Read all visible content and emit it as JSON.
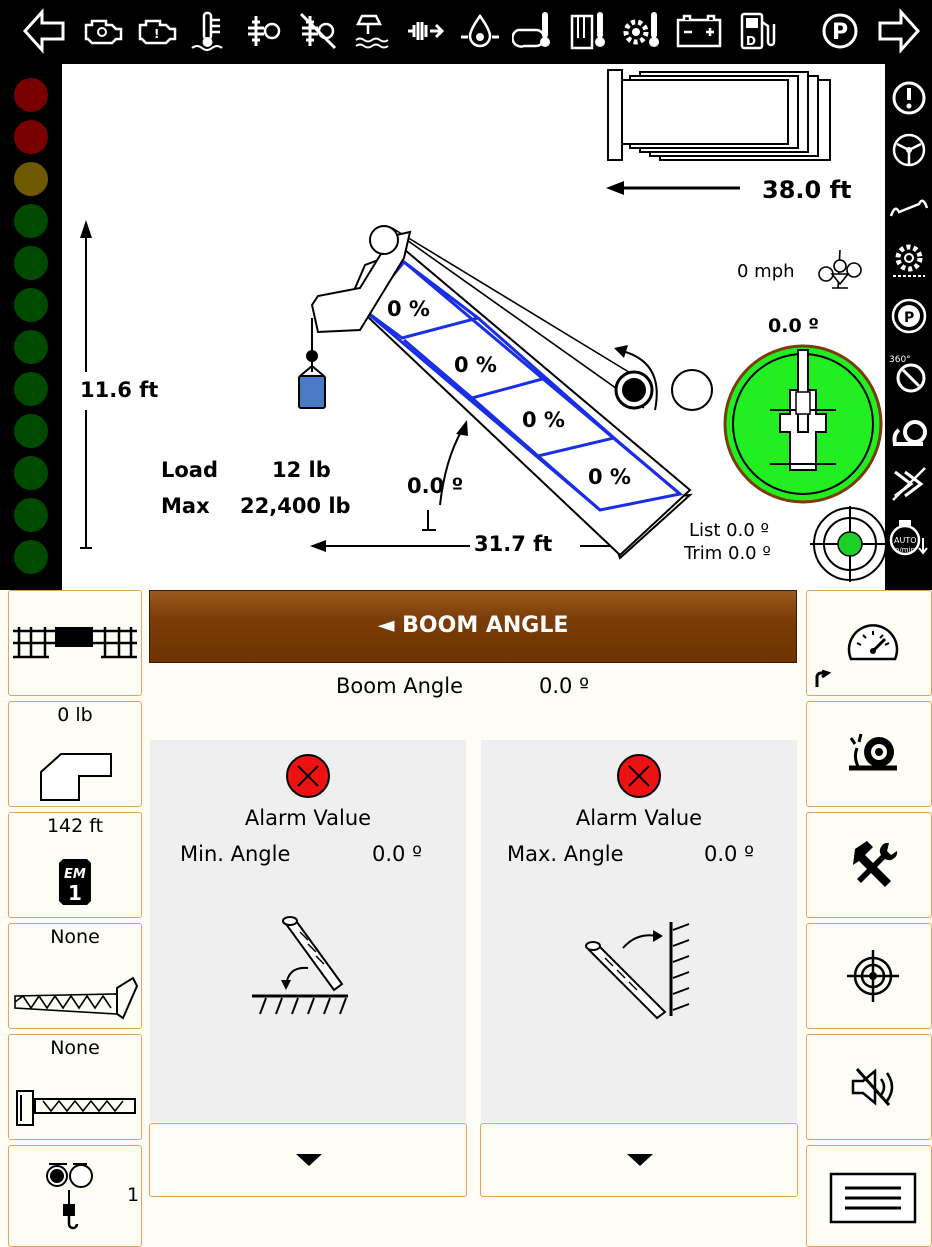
{
  "top_icons": [
    "arrow-left-icon",
    "engine-icon",
    "engine-warning-icon",
    "coolant-temp-icon",
    "transmission-icon",
    "transmission-fault-icon",
    "water-level-icon",
    "hydraulic-filter-icon",
    "oil-pressure-icon",
    "oil-temp-icon",
    "hydraulic-temp-icon",
    "gear-temp-icon",
    "battery-icon",
    "fuel-icon",
    "parking-brake-icon",
    "arrow-right-icon"
  ],
  "status_leds": [
    "#7a0000",
    "#7a0000",
    "#6d5a00",
    "#004a00",
    "#004a00",
    "#004a00",
    "#004a00",
    "#004a00",
    "#004a00",
    "#004a00",
    "#004a00",
    "#004a00"
  ],
  "radius": {
    "value": "38.0 ft"
  },
  "height": {
    "value": "11.6  ft"
  },
  "wind": {
    "value": "0  mph"
  },
  "slew": {
    "value": "0.0 º"
  },
  "boom": {
    "angle": "0.0 º",
    "length": "31.7  ft",
    "sections": [
      "0 %",
      "0 %",
      "0 %",
      "0 %"
    ]
  },
  "load": {
    "label": "Load",
    "value": "12  lb"
  },
  "max": {
    "label": "Max",
    "value": "22,400  lb"
  },
  "level": {
    "list": "List 0.0 º",
    "trim": "Trim 0.0 º"
  },
  "left_buttons": {
    "weight": "0 lb",
    "em_length": "142 ft",
    "jib1": "None",
    "jib2": "None",
    "reeving": "1"
  },
  "panel": {
    "title": "◄ BOOM ANGLE",
    "boom_angle_label": "Boom Angle",
    "boom_angle_value": "0.0 º",
    "min": {
      "alarm": "Alarm Value",
      "label": "Min. Angle",
      "value": "0.0 º"
    },
    "max": {
      "alarm": "Alarm Value",
      "label": "Max. Angle",
      "value": "0.0 º"
    }
  },
  "colors": {
    "accent": "#7a3d08",
    "button_border": "#e5a35e",
    "ok_green": "#22ee22",
    "alarm_red": "#ee1111"
  }
}
